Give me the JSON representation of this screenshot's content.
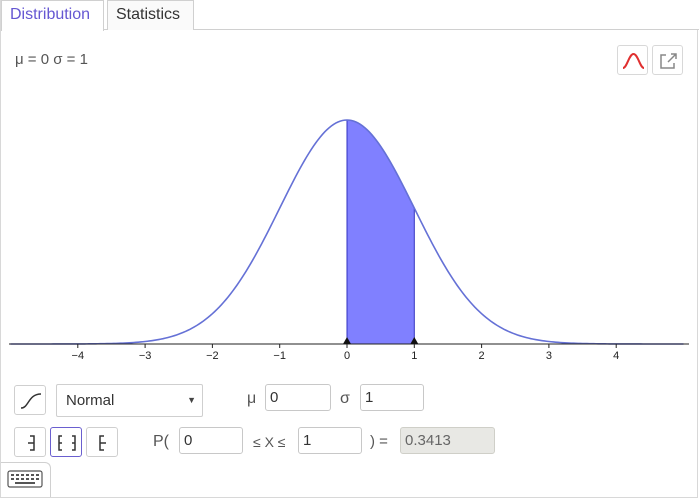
{
  "tabs": [
    {
      "label": "Distribution",
      "active": true
    },
    {
      "label": "Statistics",
      "active": false
    }
  ],
  "params_summary": "μ = 0 σ = 1",
  "chart_data": {
    "type": "line",
    "title": "",
    "xlabel": "",
    "ylabel": "",
    "distribution": "Normal",
    "mean": 0,
    "sd": 1,
    "xlim": [
      -5,
      5
    ],
    "x_ticks": [
      -4,
      -3,
      -2,
      -1,
      0,
      1,
      2,
      3,
      4
    ],
    "tick_labels": [
      "−4",
      "−3",
      "−2",
      "−1",
      "0",
      "1",
      "2",
      "3",
      "4"
    ],
    "shaded_interval": [
      0,
      1
    ],
    "markers": [
      0,
      1
    ],
    "curve_color": "#6571d6",
    "fill_color": "#8080ff",
    "grid": false
  },
  "controls": {
    "distribution_select": "Normal",
    "mu_label": "μ",
    "mu_value": "0",
    "sigma_label": "σ",
    "sigma_value": "1",
    "prob_prefix": "P(",
    "lower_value": "0",
    "between": "≤ X ≤",
    "upper_value": "1",
    "prob_suffix": ") =",
    "result": "0.3413"
  },
  "colors": {
    "accent": "#6557d2",
    "curve_icon": "#e03030"
  }
}
